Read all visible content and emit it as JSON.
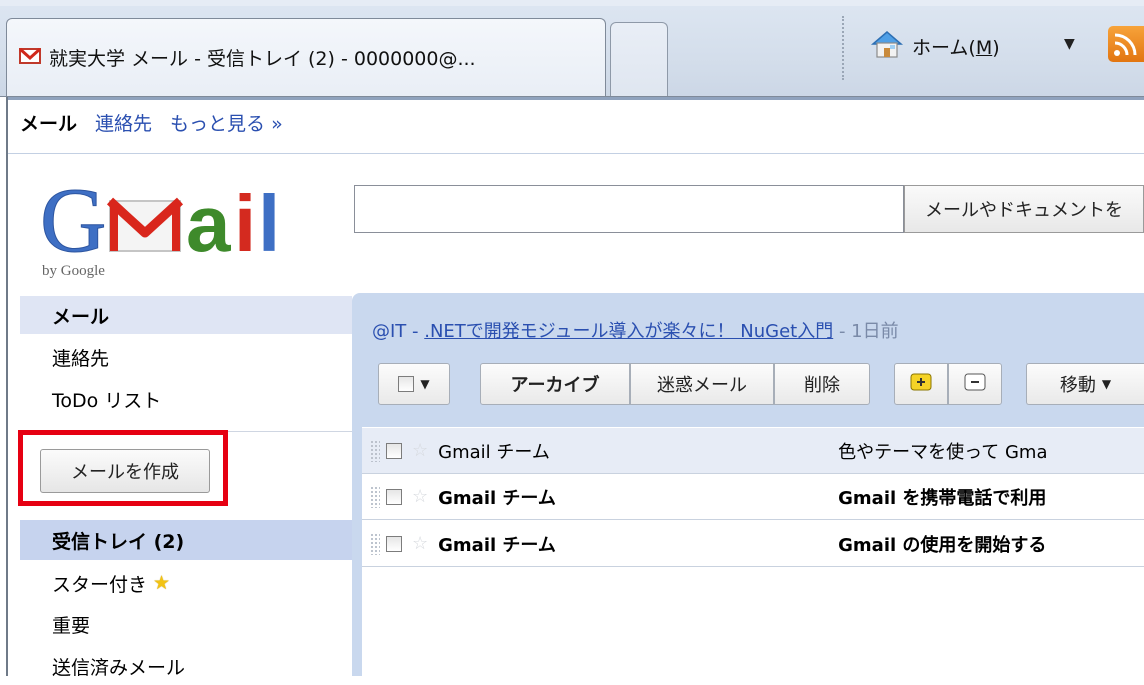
{
  "browser": {
    "tab_title": "就実大学 メール - 受信トレイ (2) - 0000000@...",
    "home_label_prefix": "ホーム(",
    "home_label_key": "M",
    "home_label_suffix": ")"
  },
  "topnav": {
    "current": "メール",
    "links": [
      "連絡先",
      "もっと見る »"
    ]
  },
  "logo": {
    "text_brand": "Gmail",
    "byline": "by Google"
  },
  "search": {
    "value": "",
    "button_label": "メールやドキュメントを"
  },
  "sidebar": {
    "top_items": [
      "メール",
      "連絡先",
      "ToDo リスト"
    ],
    "compose_label": "メールを作成",
    "folders": [
      "受信トレイ (2)",
      "スター付き",
      "重要",
      "送信済みメール"
    ]
  },
  "news": {
    "source": "@IT - ",
    "headline": ".NETで開発モジュール導入が楽々に！ NuGet入門",
    "age": " - 1日前"
  },
  "toolbar": {
    "archive": "アーカイブ",
    "spam": "迷惑メール",
    "delete": "削除",
    "move": "移動"
  },
  "emails": [
    {
      "sender": "Gmail チーム",
      "subject": "色やテーマを使って Gma",
      "unread": false
    },
    {
      "sender": "Gmail チーム",
      "subject": "Gmail を携帯電話で利用",
      "unread": true
    },
    {
      "sender": "Gmail チーム",
      "subject": "Gmail の使用を開始する",
      "unread": true
    }
  ],
  "colors": {
    "highlight": "#e60012",
    "link": "#2a4fb0",
    "panel": "#c9d8ee",
    "inbox_selected": "#c6d3ee"
  }
}
